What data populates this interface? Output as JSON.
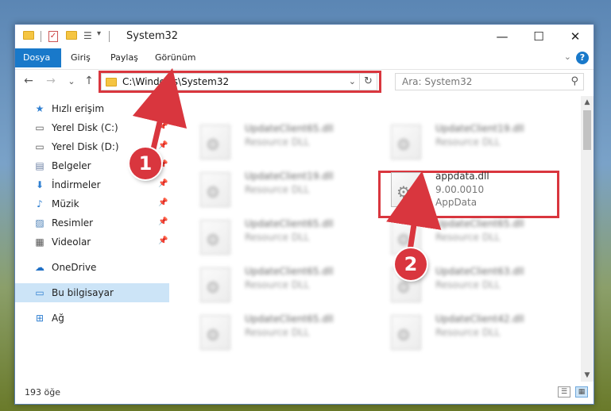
{
  "window": {
    "title": "System32",
    "quick_access_dropdown": "▾",
    "controls": {
      "minimize": "—",
      "maximize": "☐",
      "close": "✕"
    }
  },
  "ribbon": {
    "tabs": [
      {
        "label": "Dosya",
        "active": true
      },
      {
        "label": "Giriş",
        "active": false
      },
      {
        "label": "Paylaş",
        "active": false
      },
      {
        "label": "Görünüm",
        "active": false
      }
    ],
    "collapse": "⌄",
    "help": "?"
  },
  "navbar": {
    "back": "←",
    "forward": "→",
    "recent": "⌄",
    "up": "↑",
    "address": "C:\\Windows\\System32",
    "address_dropdown": "⌄",
    "refresh": "↻",
    "search_placeholder": "Ara: System32",
    "search_icon": "⚲"
  },
  "sidebar": {
    "items": [
      {
        "label": "Hızlı erişim",
        "icon": "star-icon",
        "glyph": "★",
        "color": "#2f7fd1",
        "pinned": false
      },
      {
        "label": "Yerel Disk (C:)",
        "icon": "drive-c-icon",
        "glyph": "▭",
        "color": "#555555",
        "pinned": true
      },
      {
        "label": "Yerel Disk (D:)",
        "icon": "drive-d-icon",
        "glyph": "▭",
        "color": "#555555",
        "pinned": true
      },
      {
        "label": "Belgeler",
        "icon": "documents-icon",
        "glyph": "▤",
        "color": "#6b7fa3",
        "pinned": true
      },
      {
        "label": "İndirmeler",
        "icon": "downloads-icon",
        "glyph": "⬇",
        "color": "#2f7fd1",
        "pinned": true
      },
      {
        "label": "Müzik",
        "icon": "music-icon",
        "glyph": "♪",
        "color": "#2f7fd1",
        "pinned": true
      },
      {
        "label": "Resimler",
        "icon": "pictures-icon",
        "glyph": "▨",
        "color": "#4a7fb5",
        "pinned": true
      },
      {
        "label": "Videolar",
        "icon": "videos-icon",
        "glyph": "▦",
        "color": "#555555",
        "pinned": true
      },
      {
        "label": "OneDrive",
        "icon": "onedrive-icon",
        "glyph": "☁",
        "color": "#1f6fc5",
        "pinned": false
      },
      {
        "label": "Bu bilgisayar",
        "icon": "this-pc-icon",
        "glyph": "▭",
        "color": "#2f7fd1",
        "pinned": false,
        "selected": true
      },
      {
        "label": "Ağ",
        "icon": "network-icon",
        "glyph": "⊞",
        "color": "#2f7fd1",
        "pinned": false
      }
    ],
    "pin_glyph": "📌"
  },
  "files": [
    {
      "name": "UpdateClient65.dll",
      "desc": "Resource DLL",
      "blurred": true
    },
    {
      "name": "UpdateClient19.dll",
      "desc": "Resource DLL",
      "blurred": true
    },
    {
      "name": "UpdateClient19.dll",
      "desc": "Resource DLL",
      "blurred": true
    },
    {
      "name": "appdata.dll",
      "desc": "9.00.0010",
      "desc2": "AppData",
      "blurred": false
    },
    {
      "name": "UpdateClient65.dll",
      "desc": "Resource DLL",
      "blurred": true
    },
    {
      "name": "UpdateClient65.dll",
      "desc": "Resource DLL",
      "blurred": true
    },
    {
      "name": "UpdateClient65.dll",
      "desc": "Resource DLL",
      "blurred": true
    },
    {
      "name": "UpdateClient63.dll",
      "desc": "Resource DLL",
      "blurred": true
    },
    {
      "name": "UpdateClient65.dll",
      "desc": "Resource DLL",
      "blurred": true
    },
    {
      "name": "UpdateClient42.dll",
      "desc": "Resource DLL",
      "blurred": true
    }
  ],
  "annotations": [
    {
      "label": "1"
    },
    {
      "label": "2"
    }
  ],
  "status": {
    "item_count": "193 öğe"
  },
  "colors": {
    "accent": "#1979ca",
    "highlight": "#d9363e",
    "selection": "#cce4f7"
  }
}
